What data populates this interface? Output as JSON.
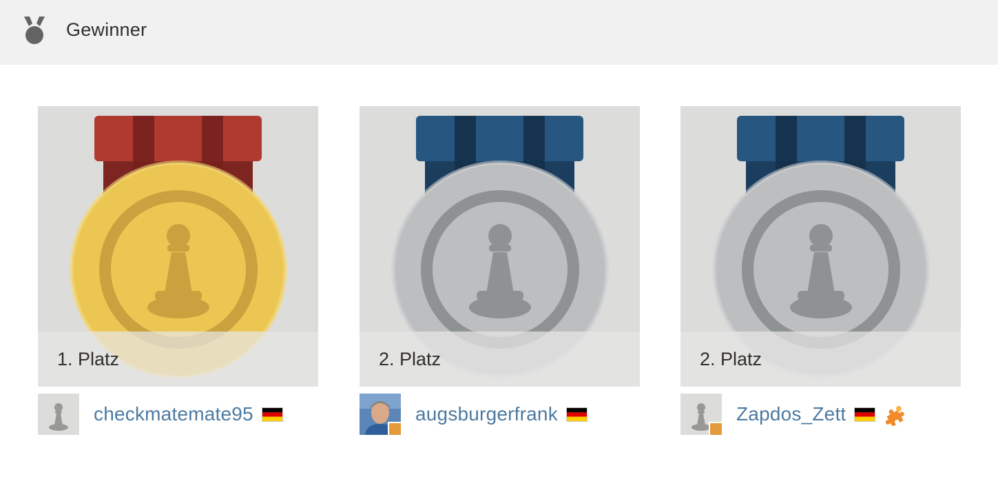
{
  "header": {
    "title": "Gewinner",
    "icon": "medal-icon"
  },
  "colors": {
    "gold": "#ecc653",
    "gold_dark": "#c9a13f",
    "silver": "#bcbebf",
    "silver_dark": "#8f9293",
    "ribbon_red": "#b13a30",
    "ribbon_blue": "#275781",
    "username": "#4d7aa1",
    "online": "#e39a3b"
  },
  "winners": [
    {
      "place": "1. Platz",
      "medal": "gold",
      "username": "checkmatemate95",
      "avatar": "pawn-placeholder",
      "flag": "germany-flag",
      "online": false,
      "extra_icon": null
    },
    {
      "place": "2. Platz",
      "medal": "silver",
      "username": "augsburgerfrank",
      "avatar": "user-photo",
      "flag": "germany-flag",
      "online": true,
      "extra_icon": null
    },
    {
      "place": "2. Platz",
      "medal": "silver",
      "username": "Zapdos_Zett",
      "avatar": "pawn-placeholder",
      "flag": "germany-flag",
      "online": true,
      "extra_icon": "puzzle-icon"
    }
  ]
}
